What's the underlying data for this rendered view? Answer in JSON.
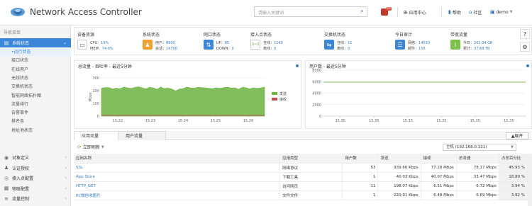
{
  "header": {
    "title": "Network Access Controller",
    "search_placeholder": "请输入关键词",
    "alert_badge": "65",
    "app_center": "应用中心",
    "help": "帮助",
    "community": "社区",
    "user": "demo"
  },
  "sidebar": {
    "heading": "导航菜单",
    "top_items": [
      {
        "label": "系统状态",
        "icon": "monitor-icon",
        "active": true
      },
      {
        "label": "对象定义",
        "icon": "object-icon"
      },
      {
        "label": "认证授权",
        "icon": "user-auth-icon"
      },
      {
        "label": "接入点配置",
        "icon": "access-point-icon"
      },
      {
        "label": "物联配置",
        "icon": "iot-icon"
      },
      {
        "label": "流量控制",
        "icon": "flow-control-icon"
      }
    ],
    "sub_items": [
      "•运行状态",
      "接口状态",
      "在线用户",
      "无线状态",
      "交换机状态",
      "智能网络拓扑图",
      "流量排行",
      "告警事件",
      "排名条",
      "地址池状态"
    ]
  },
  "status_cards": [
    {
      "title": "设备资源",
      "icon": "cpu-icon",
      "color": "#ffffff",
      "lines": [
        {
          "k": "CPU：",
          "v": "19%"
        },
        {
          "k": "MEM：",
          "v": "74.9%"
        }
      ]
    },
    {
      "title": "系统状态",
      "icon": "system-icon",
      "color": "#f0a030",
      "lines": [
        {
          "k": "用户：",
          "v": "8600"
        },
        {
          "k": "会话：",
          "v": "14700"
        }
      ]
    },
    {
      "title": "网口状态",
      "icon": "port-icon",
      "color": "#3b86d8",
      "lines": [
        {
          "k": "UP：",
          "v": "85"
        },
        {
          "k": "DOWN：",
          "v": "0"
        }
      ]
    },
    {
      "title": "接入点状态",
      "icon": "wifi-icon",
      "color": "#ffffff",
      "lines": [
        {
          "k": "在线：",
          "v": "1140"
        },
        {
          "k": "离线：",
          "v": "0"
        }
      ]
    },
    {
      "title": "交换机状态",
      "icon": "switch-icon",
      "color": "#3b86d8",
      "lines": [
        {
          "k": "在线：",
          "v": "11"
        },
        {
          "k": "离线：",
          "v": "0"
        }
      ]
    },
    {
      "title": "今日审计",
      "icon": "audit-icon",
      "color": "#3b86d8",
      "lines": [
        {
          "k": "网络：",
          "v": "14530"
        },
        {
          "k": "邮件：",
          "v": "156"
        }
      ]
    },
    {
      "title": "带宽流量",
      "icon": "traffic-icon",
      "color": "#7dc04a",
      "lines": [
        {
          "k": "今日：",
          "v": "201.04 GB"
        },
        {
          "k": "累计：",
          "v": "37.68 TB"
        }
      ]
    }
  ],
  "right_buttons": [
    {
      "icon": "help-icon",
      "glyph": "?"
    },
    {
      "icon": "settings-icon",
      "glyph": "⚙"
    }
  ],
  "chart_data": [
    {
      "type": "area",
      "title": "总流量 - 吞吐率 - 最近5分钟",
      "ylabel": "Mbps",
      "ylim": [
        0,
        300
      ],
      "yticks": [
        0,
        100,
        200,
        300
      ],
      "xticks": [
        "15.22",
        "15.23",
        "15.24",
        "15.25",
        "15.26"
      ],
      "legend": [
        "发送",
        "接收"
      ],
      "series": [
        {
          "name": "发送",
          "color": "#6cb33f",
          "values": [
            218,
            225,
            224,
            212,
            220,
            214,
            228,
            222,
            217,
            225,
            230,
            222,
            214,
            226,
            222,
            210,
            228,
            216,
            220,
            212,
            198,
            212,
            215,
            228,
            221,
            219,
            226,
            224,
            222,
            218,
            215,
            223,
            218,
            224,
            228,
            220,
            222,
            210,
            226,
            223,
            213,
            222,
            217,
            222,
            228
          ]
        },
        {
          "name": "接收",
          "color": "#c0504d",
          "values": [
            6,
            6,
            6,
            6,
            6,
            6,
            6,
            6,
            6,
            6,
            6,
            6,
            6,
            6,
            6,
            6,
            6,
            6,
            6,
            6,
            6,
            6,
            6,
            6,
            6,
            6,
            6,
            6,
            6,
            6,
            6,
            6,
            6,
            6,
            6,
            6,
            6,
            6,
            6,
            6,
            6,
            6,
            6,
            6,
            6
          ]
        }
      ]
    },
    {
      "type": "line",
      "title": "用户数 - 最近5分钟",
      "ylim": [
        0,
        8000
      ],
      "yticks": [
        0,
        2000,
        4000,
        6000,
        8000
      ],
      "xticks": [
        "15.35",
        "15.35",
        "15.35",
        "15.35",
        "15.35",
        "15.35"
      ],
      "series": [
        {
          "name": "",
          "color": "#7dc04a",
          "values": [
            5900,
            5900
          ]
        }
      ]
    }
  ],
  "tabs": [
    "应用流量",
    "用户流量"
  ],
  "expand_label": "▲展开",
  "refresh_label": "立即刷新",
  "host_select": "主机 (192.168.0.131)",
  "table": {
    "headers": [
      "应用名称",
      "应用类型",
      "用户数",
      "发送",
      "接收",
      "总流速",
      "占总百分比"
    ],
    "rows": [
      [
        "SSL",
        "网络协议",
        "53",
        "939.66 Kbps",
        "77.28 Mbps",
        "78.17 Mbps",
        "45.93 %"
      ],
      [
        "App Store",
        "下载工具",
        "1",
        "40.03 Kbps",
        "40.07 Mbps",
        "33.47 Mbps",
        "18.80 %"
      ],
      [
        "HTTP_GET",
        "访问网页",
        "11",
        "198.07 Kbps",
        "6.51 Mbps",
        "6.72 Mbps",
        "3.94 %"
      ],
      [
        "PC微信收图片",
        "文件文件",
        "1",
        "220.91 Kbps",
        "6.48 Mbps",
        "6.69 Mbps",
        "3.92 %"
      ]
    ]
  }
}
